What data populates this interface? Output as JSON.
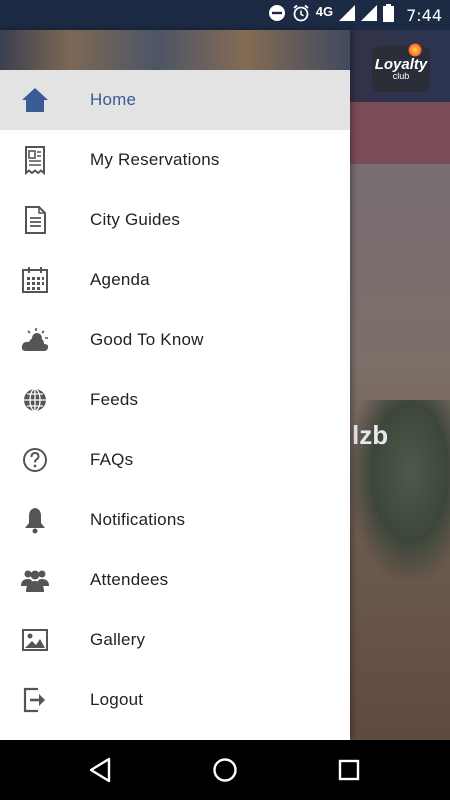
{
  "status_bar": {
    "network": "4G",
    "time": "7:44",
    "icons": [
      "do-not-disturb-icon",
      "alarm-icon",
      "signal-icon",
      "signal-icon",
      "battery-icon"
    ]
  },
  "background": {
    "logo_top": "Loyalty",
    "logo_bottom": "club",
    "overlay_text": "lzb"
  },
  "drawer": {
    "items": [
      {
        "label": "Home",
        "icon": "home-icon",
        "selected": true
      },
      {
        "label": "My Reservations",
        "icon": "reservations-icon"
      },
      {
        "label": "City Guides",
        "icon": "document-icon"
      },
      {
        "label": "Agenda",
        "icon": "calendar-icon"
      },
      {
        "label": "Good To Know",
        "icon": "weather-cloud-icon"
      },
      {
        "label": "Feeds",
        "icon": "globe-icon"
      },
      {
        "label": "FAQs",
        "icon": "question-icon"
      },
      {
        "label": "Notifications",
        "icon": "bell-icon"
      },
      {
        "label": "Attendees",
        "icon": "people-icon"
      },
      {
        "label": "Gallery",
        "icon": "image-icon"
      },
      {
        "label": "Logout",
        "icon": "logout-icon"
      }
    ]
  },
  "colors": {
    "accent": "#3b5a98",
    "icon": "#555555",
    "selected_bg": "#e3e3e3"
  }
}
